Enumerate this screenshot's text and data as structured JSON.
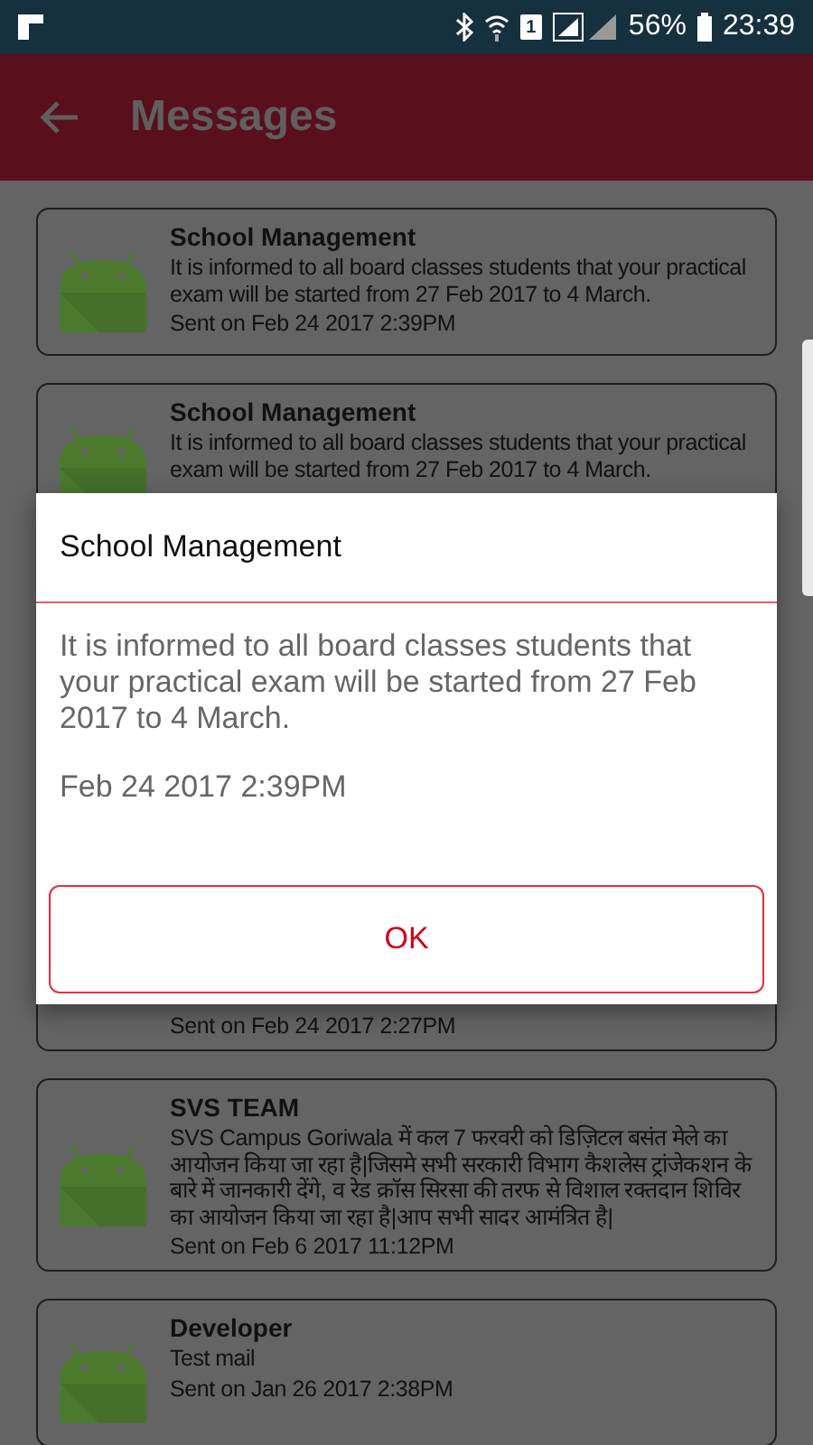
{
  "status_bar": {
    "sim": "1",
    "battery": "56%",
    "time": "23:39"
  },
  "app_bar": {
    "title": "Messages"
  },
  "messages": [
    {
      "title": "School Management",
      "body": "It is informed to all board classes students that your practical exam will be started from 27 Feb 2017 to 4 March.",
      "sent": "Sent on Feb 24 2017  2:39PM"
    },
    {
      "title": "School Management",
      "body": "It is informed to all board classes students that your practical exam will be started from 27 Feb 2017 to 4 March."
    },
    {
      "sent": "Sent on Feb 24 2017  2:27PM"
    },
    {
      "title": "SVS TEAM",
      "body": "SVS Campus Goriwala में कल 7 फरवरी को डिज़िटल बसंत मेले का आयोजन किया जा रहा है|जिसमे सभी सरकारी विभाग कैशलेस ट्रांजेकशन के बारे में जानकारी देंगे, व रेड क्रॉस सिरसा की तरफ से विशाल रक्तदान शिविर का आयोजन किया जा रहा है|आप सभी सादर आमंत्रित है|",
      "sent": "Sent on Feb  6 2017 11:12PM"
    },
    {
      "title": "Developer",
      "body": "Test mail",
      "sent": "Sent on Jan 26 2017  2:38PM"
    }
  ],
  "dialog": {
    "title": "School Management",
    "body": "It is informed to all board classes students that your practical exam will be started from 27 Feb 2017 to 4 March.",
    "date": "Feb 24 2017  2:39PM",
    "button": "OK"
  }
}
